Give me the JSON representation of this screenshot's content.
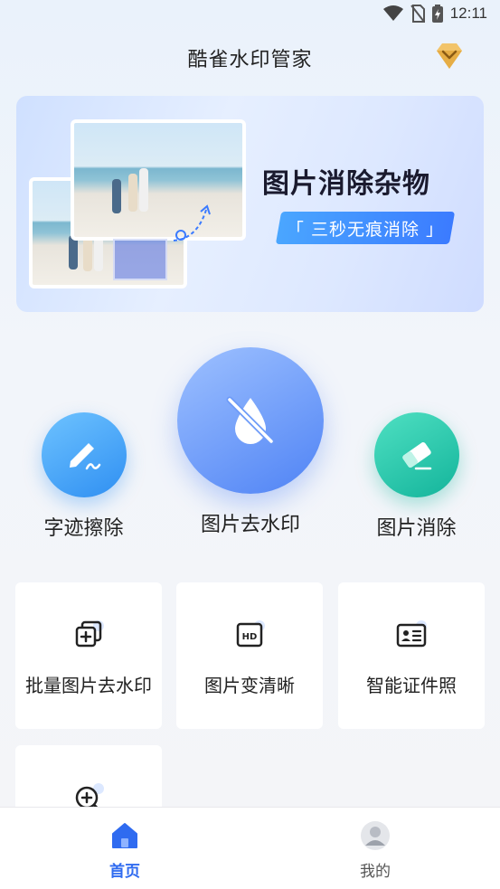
{
  "status_bar": {
    "time": "12:11"
  },
  "header": {
    "title": "酷雀水印管家",
    "vip_icon": "diamond-crown-icon"
  },
  "banner": {
    "headline": "图片消除杂物",
    "pill": "「 三秒无痕消除 」"
  },
  "features": [
    {
      "label": "字迹擦除",
      "icon": "pen-signature-icon"
    },
    {
      "label": "图片去水印",
      "icon": "no-watermark-drop-icon"
    },
    {
      "label": "图片消除",
      "icon": "eraser-icon"
    }
  ],
  "tools": [
    {
      "label": "批量图片去水印",
      "icon": "batch-add-icon"
    },
    {
      "label": "图片变清晰",
      "icon": "hd-icon"
    },
    {
      "label": "智能证件照",
      "icon": "id-card-icon"
    },
    {
      "label": "",
      "icon": "zoom-in-icon"
    }
  ],
  "nav": {
    "home": "首页",
    "mine": "我的"
  },
  "colors": {
    "accent": "#2f6bf0",
    "teal": "#13b49b",
    "blue": "#2f8ff2"
  }
}
